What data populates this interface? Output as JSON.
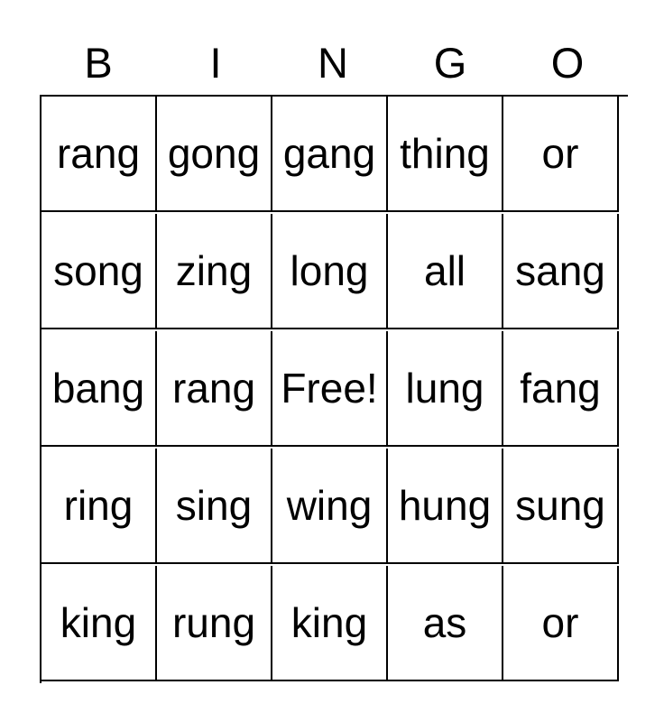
{
  "card": {
    "title": "BINGO",
    "headers": [
      "B",
      "I",
      "N",
      "G",
      "O"
    ],
    "free_space_label": "Free!",
    "colors": {
      "background": "#ffffff",
      "text": "#000000",
      "border": "#000000"
    },
    "rows": [
      [
        "rang",
        "gong",
        "gang",
        "thing",
        "or"
      ],
      [
        "song",
        "zing",
        "long",
        "all",
        "sang"
      ],
      [
        "bang",
        "rang",
        "Free!",
        "lung",
        "fang"
      ],
      [
        "ring",
        "sing",
        "wing",
        "hung",
        "sung"
      ],
      [
        "king",
        "rung",
        "king",
        "as",
        "or"
      ]
    ]
  }
}
